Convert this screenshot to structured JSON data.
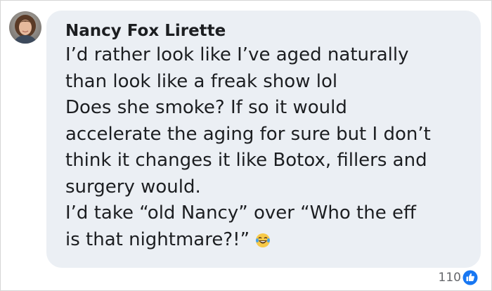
{
  "comment": {
    "author": "Nancy Fox Lirette",
    "lines": [
      "I’d rather look like I’ve aged naturally",
      "than look like a freak show lol",
      "Does she smoke? If so it would",
      "accelerate the aging for sure but I don’t",
      "think it changes it like Botox, fillers and",
      "surgery would.",
      "I’d take “old Nancy” over “Who the eff",
      "is that nightmare?!”"
    ],
    "trailing_emoji": "laughing-tears-emoji"
  },
  "reactions": {
    "count": "110",
    "icon": "like-thumbs-up-icon",
    "icon_color": "#1877f2"
  },
  "colors": {
    "bubble": "#ebeff4",
    "text": "#1c1e21",
    "meta": "#65676b"
  }
}
